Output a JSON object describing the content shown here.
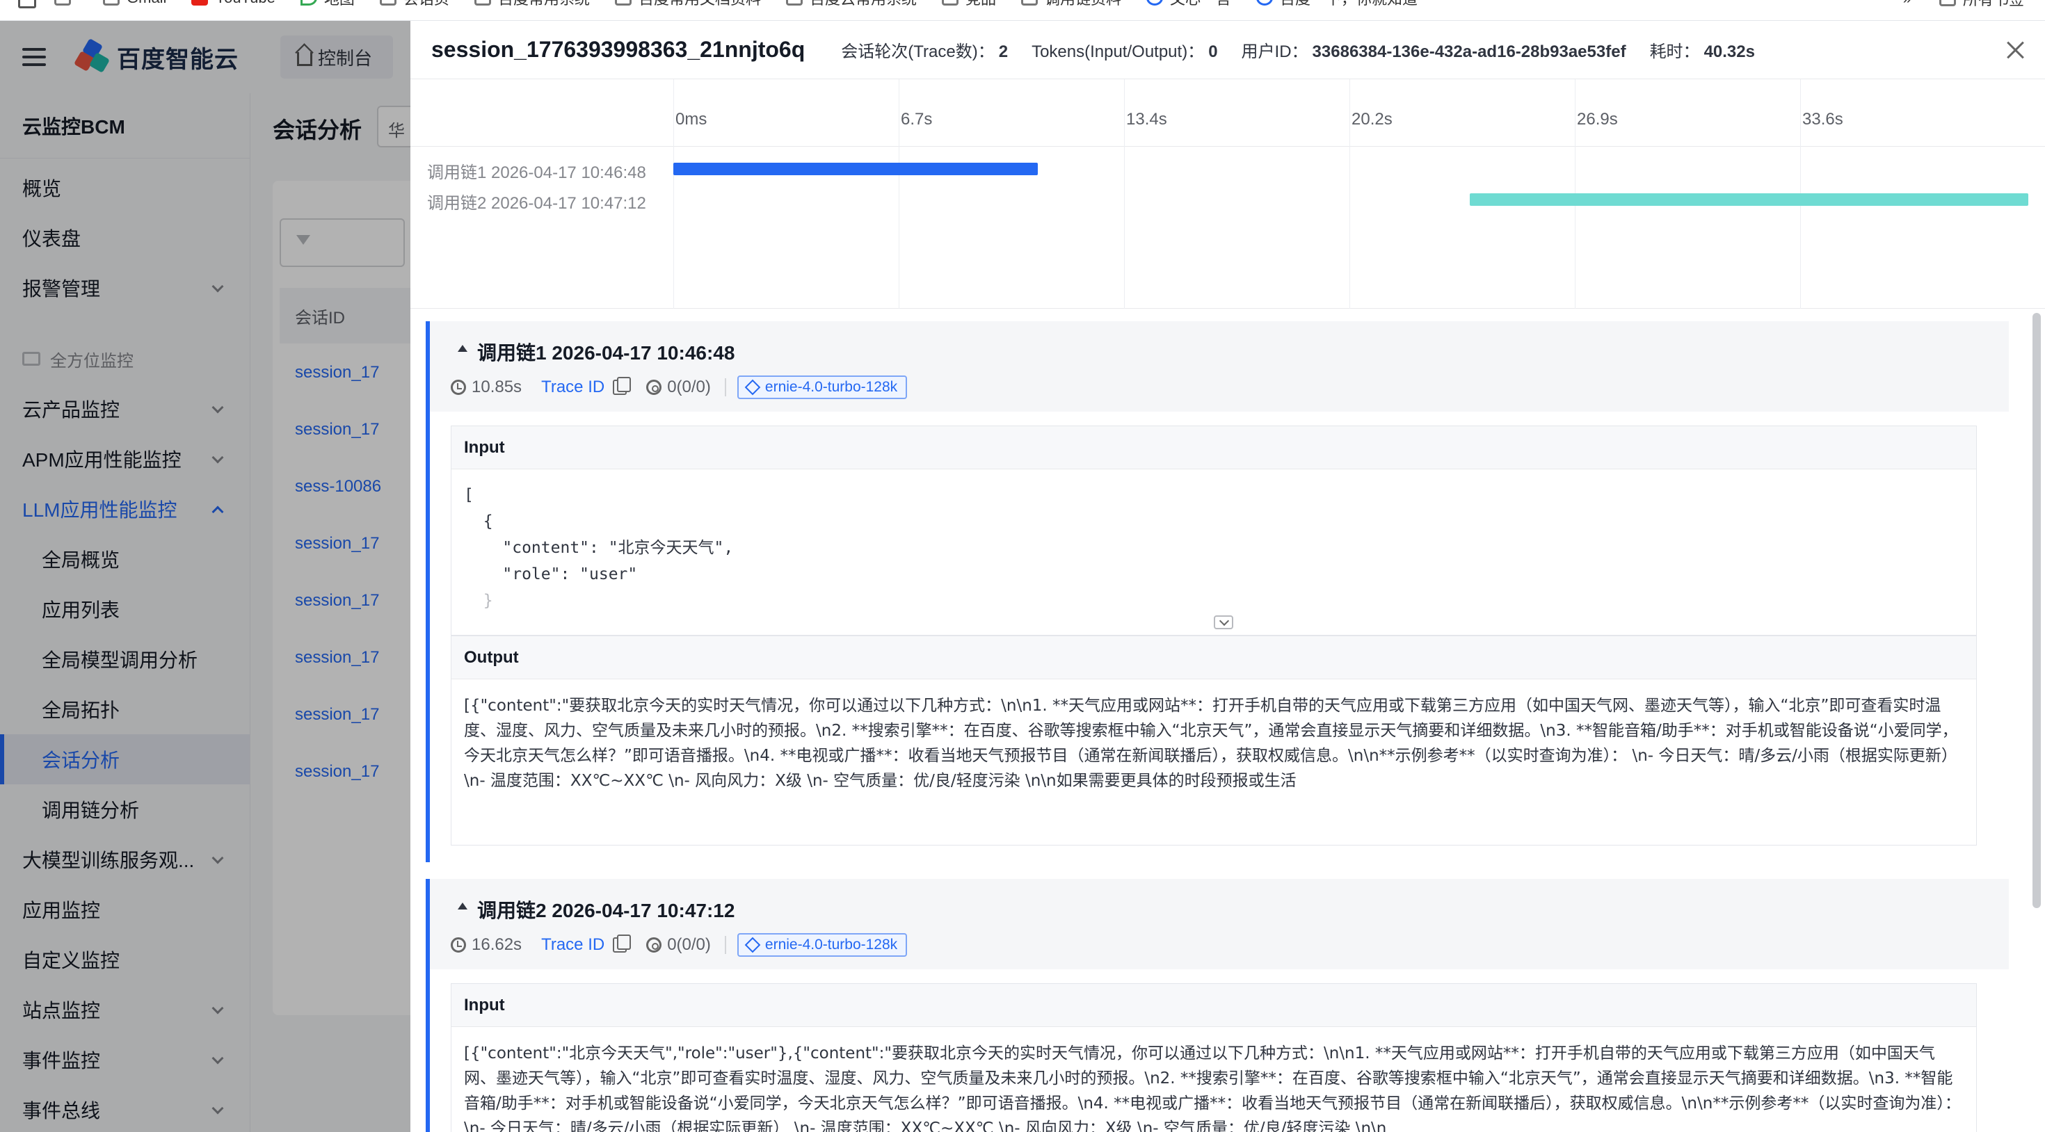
{
  "bookmarks": [
    {
      "label": "",
      "icon": "folder-icon"
    },
    {
      "label": "Gmail",
      "icon": "gmail-icon"
    },
    {
      "label": "YouTube",
      "icon": "youtube-icon"
    },
    {
      "label": "地图",
      "icon": "maps-icon"
    },
    {
      "label": "会话页",
      "icon": "folder-icon"
    },
    {
      "label": "百度常用系统",
      "icon": "folder-icon"
    },
    {
      "label": "百度常用文档资料",
      "icon": "folder-icon"
    },
    {
      "label": "百度云常用系统",
      "icon": "folder-icon"
    },
    {
      "label": "竞品",
      "icon": "folder-icon"
    },
    {
      "label": "调用链资料",
      "icon": "folder-icon"
    },
    {
      "label": "文心一言",
      "icon": "wenxin-icon"
    },
    {
      "label": "百度一下，你就知道",
      "icon": "baidu-icon"
    }
  ],
  "bookmarks_right": {
    "more": "»",
    "all": "所有书签"
  },
  "topbar": {
    "logo_text": "百度智能云",
    "console_label": "控制台"
  },
  "sidebar": {
    "title": "云监控BCM",
    "items": [
      {
        "label": "概览",
        "type": "item"
      },
      {
        "label": "仪表盘",
        "type": "item"
      },
      {
        "label": "报警管理",
        "type": "item",
        "chevron": "down"
      },
      {
        "label": "全方位监控",
        "type": "group"
      },
      {
        "label": "云产品监控",
        "type": "item",
        "chevron": "down"
      },
      {
        "label": "APM应用性能监控",
        "type": "item",
        "chevron": "down"
      },
      {
        "label": "LLM应用性能监控",
        "type": "item",
        "chevron": "up",
        "state": "open"
      },
      {
        "label": "全局概览",
        "type": "sub"
      },
      {
        "label": "应用列表",
        "type": "sub"
      },
      {
        "label": "全局模型调用分析",
        "type": "sub"
      },
      {
        "label": "全局拓扑",
        "type": "sub"
      },
      {
        "label": "会话分析",
        "type": "sub",
        "state": "active"
      },
      {
        "label": "调用链分析",
        "type": "sub"
      },
      {
        "label": "大模型训练服务观...",
        "type": "item",
        "chevron": "down"
      },
      {
        "label": "应用监控",
        "type": "item"
      },
      {
        "label": "自定义监控",
        "type": "item"
      },
      {
        "label": "站点监控",
        "type": "item",
        "chevron": "down"
      },
      {
        "label": "事件监控",
        "type": "item",
        "chevron": "down"
      },
      {
        "label": "事件总线",
        "type": "item",
        "chevron": "down"
      }
    ]
  },
  "background": {
    "page_title": "会话分析",
    "select_value": "华",
    "table_header": "会话ID",
    "rows": [
      "session_17",
      "session_17",
      "sess-10086",
      "session_17",
      "session_17",
      "session_17",
      "session_17",
      "session_17"
    ]
  },
  "drawer": {
    "title": "session_1776393998363_21nnjto6q",
    "meta": [
      {
        "label": "会话轮次(Trace数)：",
        "value": "2"
      },
      {
        "label": "Tokens(Input/Output)：",
        "value": "0"
      },
      {
        "label": "用户ID：",
        "value": "33686384-136e-432a-ad16-28b93ae53fef"
      },
      {
        "label": "耗时：",
        "value": "40.32s"
      }
    ]
  },
  "timeline": {
    "ticks": [
      "0ms",
      "6.7s",
      "13.4s",
      "20.2s",
      "26.9s",
      "33.6s"
    ],
    "total_seconds": 40.32,
    "rows": [
      {
        "label": "调用链1 2026-04-17 10:46:48",
        "start_s": 0,
        "duration_s": 10.85,
        "color": "#2468f2"
      },
      {
        "label": "调用链2 2026-04-17 10:47:12",
        "start_s": 23.7,
        "duration_s": 16.62,
        "color": "#6fdbd2"
      }
    ]
  },
  "traces": [
    {
      "title": "调用链1 2026-04-17 10:46:48",
      "duration": "10.85s",
      "trace_id_label": "Trace ID",
      "tokens": "0(0/0)",
      "model": "ernie-4.0-turbo-128k",
      "input_label": "Input",
      "input_lines": [
        "[",
        "  {",
        "    \"content\": \"北京今天天气\",",
        "    \"role\": \"user\"",
        "  }"
      ],
      "output_label": "Output",
      "output_text": "[{\"content\":\"要获取北京今天的实时天气情况，你可以通过以下几种方式：\\n\\n1. **天气应用或网站**：打开手机自带的天气应用或下载第三方应用（如中国天气网、墨迹天气等），输入“北京”即可查看实时温度、湿度、风力、空气质量及未来几小时的预报。\\n2. **搜索引擎**：在百度、谷歌等搜索框中输入“北京天气”，通常会直接显示天气摘要和详细数据。\\n3. **智能音箱/助手**：对手机或智能设备说“小爱同学，今天北京天气怎么样？”即可语音播报。\\n4. **电视或广播**：收看当地天气预报节目（通常在新闻联播后），获取权威信息。\\n\\n**示例参考**（以实时查询为准）：  \\n- 今日天气：晴/多云/小雨（根据实际更新）  \\n- 温度范围：XX℃~XX℃  \\n- 风向风力：X级  \\n- 空气质量：优/良/轻度污染  \\n\\n如果需要更具体的时段预报或生活"
    },
    {
      "title": "调用链2 2026-04-17 10:47:12",
      "duration": "16.62s",
      "trace_id_label": "Trace ID",
      "tokens": "0(0/0)",
      "model": "ernie-4.0-turbo-128k",
      "input_label": "Input",
      "input_text": "[{\"content\":\"北京今天天气\",\"role\":\"user\"},{\"content\":\"要获取北京今天的实时天气情况，你可以通过以下几种方式：\\n\\n1. **天气应用或网站**：打开手机自带的天气应用或下载第三方应用（如中国天气网、墨迹天气等），输入“北京”即可查看实时温度、湿度、风力、空气质量及未来几小时的预报。\\n2. **搜索引擎**：在百度、谷歌等搜索框中输入“北京天气”，通常会直接显示天气摘要和详细数据。\\n3. **智能音箱/助手**：对手机或智能设备说“小爱同学，今天北京天气怎么样？”即可语音播报。\\n4. **电视或广播**：收看当地天气预报节目（通常在新闻联播后），获取权威信息。\\n\\n**示例参考**（以实时查询为准）：  \\n- 今日天气：晴/多云/小雨（根据实际更新）  \\n- 温度范围：XX℃~XX℃  \\n- 风向风力：X级  \\n- 空气质量：优/良/轻度污染  \\n\\n"
    }
  ],
  "colors": {
    "accent": "#2468f2",
    "bar1": "#2468f2",
    "bar2": "#6fdbd2"
  }
}
